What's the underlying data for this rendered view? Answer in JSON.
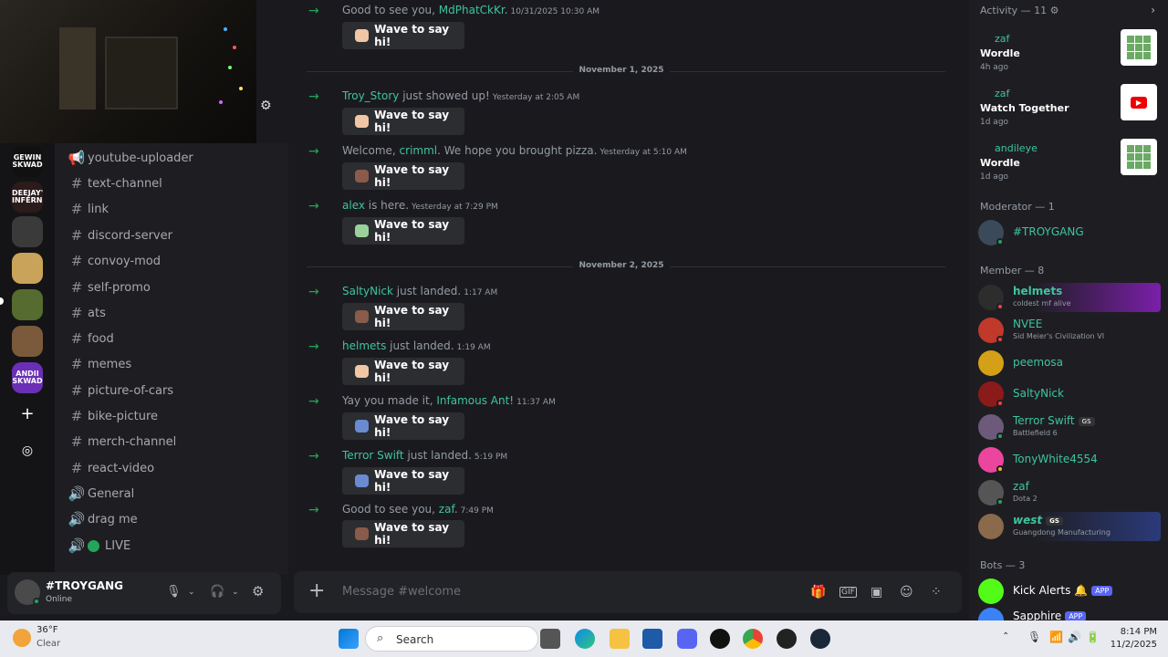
{
  "channels": [
    {
      "type": "announce",
      "name": "youtube-uploader"
    },
    {
      "type": "text",
      "name": "text-channel"
    },
    {
      "type": "text",
      "name": "link"
    },
    {
      "type": "text",
      "name": "discord-server"
    },
    {
      "type": "text",
      "name": "convoy-mod"
    },
    {
      "type": "text",
      "name": "self-promo"
    },
    {
      "type": "text",
      "name": "ats"
    },
    {
      "type": "text",
      "name": "food"
    },
    {
      "type": "text",
      "name": "memes"
    },
    {
      "type": "text",
      "name": "picture-of-cars"
    },
    {
      "type": "text",
      "name": "bike-picture"
    },
    {
      "type": "text",
      "name": "merch-channel"
    },
    {
      "type": "text",
      "name": "react-video"
    },
    {
      "type": "voice",
      "name": "General"
    },
    {
      "type": "voice",
      "name": "drag me"
    },
    {
      "type": "voice",
      "name": "LIVE"
    }
  ],
  "servers": [
    {
      "label": "GEWIN SKWAD",
      "color": "#111111"
    },
    {
      "label": "DEEJAY'S INFERNO",
      "color": "#2b1b1b"
    },
    {
      "label": "",
      "color": "#3a3a3a"
    },
    {
      "label": "",
      "color": "#c9a35a"
    },
    {
      "label": "",
      "color": "#556b2f"
    },
    {
      "label": "",
      "color": "#7a5a3a"
    },
    {
      "label": "ANDII SKWAD",
      "color": "#6a2fb5"
    }
  ],
  "userbar": {
    "name": "#TROYGANG",
    "status": "Online"
  },
  "messages": [
    {
      "pre": "Good to see you, ",
      "user": "MdPhatCkKr",
      "post": ".",
      "time": "10/31/2025 10:30 AM",
      "wave": "Wave to say hi!"
    },
    {
      "pre": "",
      "user": "Troy_Story",
      "post": " just showed up!",
      "time": "Yesterday at 2:05 AM",
      "wave": "Wave to say hi!"
    },
    {
      "pre": "Welcome, ",
      "user": "crimml",
      "post": ". We hope you brought pizza.",
      "time": "Yesterday at 5:10 AM",
      "wave": "Wave to say hi!"
    },
    {
      "pre": "",
      "user": "alex",
      "post": " is here.",
      "time": "Yesterday at 7:29 PM",
      "wave": "Wave to say hi!"
    },
    {
      "pre": "",
      "user": "SaltyNick",
      "post": " just landed.",
      "time": "1:17 AM",
      "wave": "Wave to say hi!"
    },
    {
      "pre": "",
      "user": "helmets",
      "post": " just landed.",
      "time": "1:19 AM",
      "wave": "Wave to say hi!"
    },
    {
      "pre": "Yay you made it, ",
      "user": "Infamous Ant",
      "post": "!",
      "time": "11:37 AM",
      "wave": "Wave to say hi!"
    },
    {
      "pre": "",
      "user": "Terror Swift",
      "post": " just landed.",
      "time": "5:19 PM",
      "wave": "Wave to say hi!"
    },
    {
      "pre": "Good to see you, ",
      "user": "zaf",
      "post": ".",
      "time": "7:49 PM",
      "wave": "Wave to say hi!"
    }
  ],
  "dividers": [
    "November 1, 2025",
    "November 2, 2025"
  ],
  "composer": {
    "placeholder": "Message #welcome"
  },
  "activity": {
    "header": "Activity — 11",
    "items": [
      {
        "who": "zaf",
        "game": "Wordle",
        "ago": "4h ago",
        "icon": "wordle-icon"
      },
      {
        "who": "zaf",
        "game": "Watch Together",
        "ago": "1d ago",
        "icon": "youtube-icon"
      },
      {
        "who": "andileye",
        "game": "Wordle",
        "ago": "1d ago",
        "icon": "wordle-icon"
      }
    ]
  },
  "moderators": {
    "header": "Moderator — 1",
    "items": [
      {
        "name": "#TROYGANG",
        "sub": ""
      }
    ]
  },
  "members": {
    "header": "Member — 8",
    "items": [
      {
        "name": "helmets",
        "sub": "coldest mf alive",
        "color": "#2d2d2d"
      },
      {
        "name": "NVEE",
        "sub": "Sid Meier's Civilization VI",
        "color": "#c0392b"
      },
      {
        "name": "peemosa",
        "sub": "",
        "color": "#d4a017"
      },
      {
        "name": "SaltyNick",
        "sub": "",
        "color": "#8b1a1a"
      },
      {
        "name": "Terror Swift",
        "sub": "Battlefield 6",
        "color": "#6d5a7a",
        "tag": "GS"
      },
      {
        "name": "TonyWhite4554",
        "sub": "",
        "color": "#eb459e"
      },
      {
        "name": "zaf",
        "sub": "Dota 2",
        "color": "#555555"
      },
      {
        "name": "west",
        "sub": "Guangdong Manufacturing",
        "color": "#8a6a4a",
        "tag": "GS"
      }
    ]
  },
  "bots": {
    "header": "Bots — 3",
    "items": [
      {
        "name": "Kick Alerts",
        "badge": "APP"
      },
      {
        "name": "Sapphire",
        "badge": "APP"
      }
    ]
  },
  "taskbar": {
    "temp": "36°F",
    "cond": "Clear",
    "search": "Search",
    "time": "8:14 PM",
    "date": "11/2/2025"
  }
}
